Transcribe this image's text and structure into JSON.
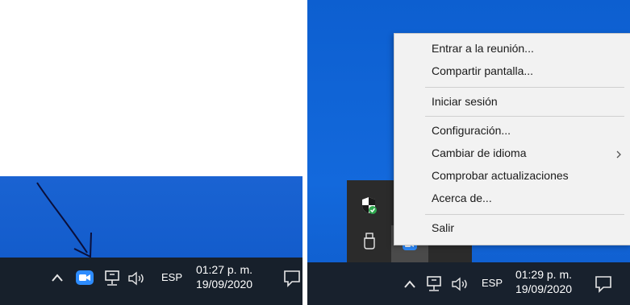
{
  "left": {
    "clock_time": "01:27 p. m.",
    "clock_date": "19/09/2020",
    "language": "ESP"
  },
  "right": {
    "clock_time": "01:29 p. m.",
    "clock_date": "19/09/2020",
    "language": "ESP",
    "menu": {
      "join_meeting": "Entrar a la reunión...",
      "share_screen": "Compartir pantalla...",
      "sign_in": "Iniciar sesión",
      "settings": "Configuración...",
      "change_language": "Cambiar de idioma",
      "check_updates": "Comprobar actualizaciones",
      "about": "Acerca de...",
      "exit": "Salir"
    }
  },
  "colors": {
    "desktop_blue": "#1565d8",
    "taskbar": "#17202b",
    "zoom_blue": "#2d8cff",
    "menu_bg": "#f2f2f2"
  }
}
